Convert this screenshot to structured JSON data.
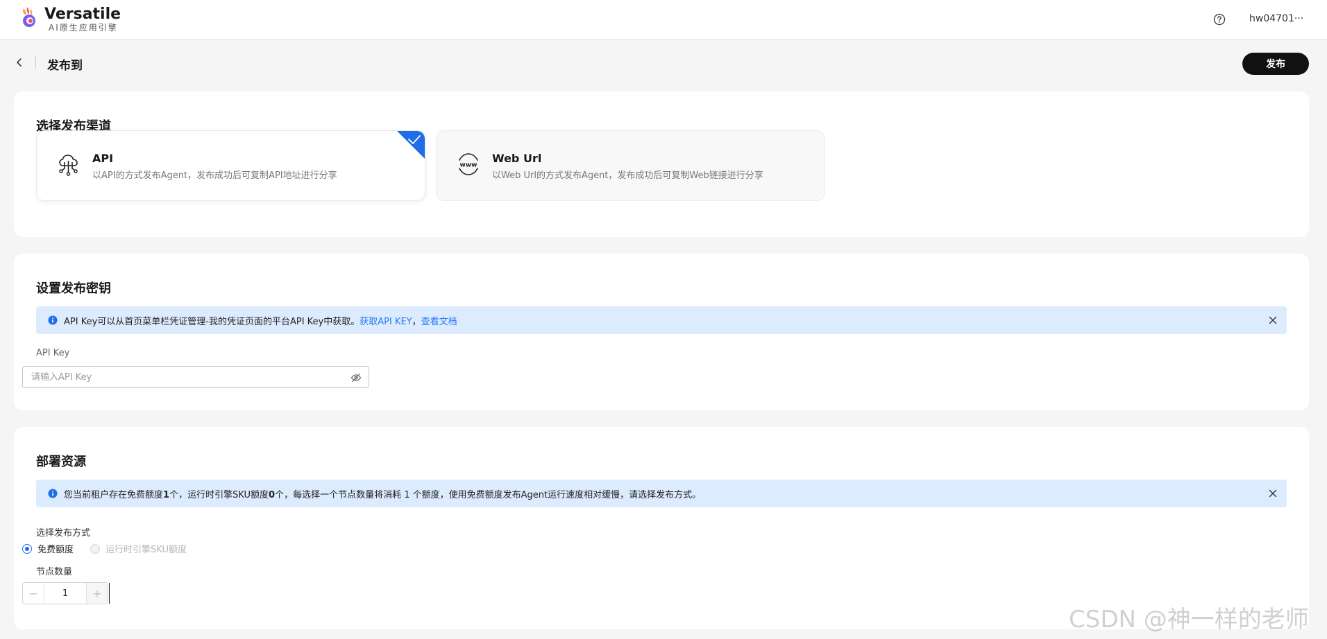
{
  "header": {
    "brand_name": "Versatile",
    "brand_sub": "AI原生应用引擎",
    "user_name": "hw04701···"
  },
  "page": {
    "title": "发布到",
    "publish_label": "发布"
  },
  "channel_section": {
    "title": "选择发布渠道",
    "options": [
      {
        "name": "API",
        "desc": "以API的方式发布Agent，发布成功后可复制API地址进行分享",
        "icon": "cloud-network-icon",
        "selected": true
      },
      {
        "name": "Web Url",
        "desc": "以Web Url的方式发布Agent，发布成功后可复制Web链接进行分享",
        "icon": "www-icon",
        "selected": false
      }
    ]
  },
  "key_section": {
    "title": "设置发布密钥",
    "alert_text": "API Key可以从首页菜单栏凭证管理-我的凭证页面的平台API Key中获取。",
    "alert_link1": "获取API KEY",
    "alert_sep": "，",
    "alert_link2": "查看文档",
    "field_label": "API Key",
    "placeholder": "请输入API Key"
  },
  "resource_section": {
    "title": "部署资源",
    "alert_pre": "您当前租户存在免费额度",
    "alert_b1": "1",
    "alert_mid1": "个，运行时引擎SKU额度",
    "alert_b2": "0",
    "alert_post": "个，每选择一个节点数量将消耗 1 个额度，使用免费额度发布Agent运行速度相对缓慢，请选择发布方式。",
    "mode_label": "选择发布方式",
    "mode_options": [
      "免费额度",
      "运行时引擎SKU额度"
    ],
    "node_label": "节点数量",
    "node_value": "1"
  },
  "watermark": "CSDN @神一样的老师",
  "colors": {
    "accent": "#1e6ee8",
    "alert_bg": "#dcebfe",
    "link": "#2779f5",
    "button_bg": "#111111"
  }
}
